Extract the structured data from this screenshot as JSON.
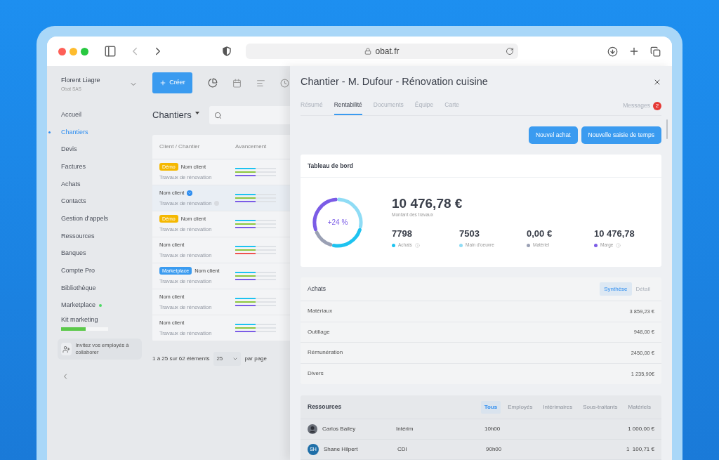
{
  "browser": {
    "url": "obat.fr"
  },
  "user": {
    "name": "Florent Liagre",
    "company": "Obat SAS"
  },
  "nav": [
    {
      "label": "Accueil",
      "selected": false
    },
    {
      "label": "Chantiers",
      "selected": true
    },
    {
      "label": "Devis",
      "selected": false
    },
    {
      "label": "Factures",
      "selected": false
    },
    {
      "label": "Achats",
      "selected": false
    },
    {
      "label": "Contacts",
      "selected": false
    },
    {
      "label": "Gestion d’appels",
      "selected": false
    },
    {
      "label": "Ressources",
      "selected": false
    },
    {
      "label": "Banques",
      "selected": false
    },
    {
      "label": "Compte Pro",
      "selected": false
    },
    {
      "label": "Bibliothèque",
      "selected": false
    },
    {
      "label": "Marketplace",
      "selected": false,
      "color": "#4cd964"
    },
    {
      "label": "Kit marketing",
      "selected": false,
      "level": 0.52
    }
  ],
  "invite": "Invitez vos employés à collaborer",
  "create_button": "Créer",
  "list": {
    "title": "Chantiers",
    "columns": [
      "Client / Chantier",
      "Avancement"
    ],
    "rows": [
      {
        "name": "Nom client",
        "subtitle": "Travaux de rénovation",
        "tag": {
          "kind": "demo",
          "label": "Démo"
        },
        "selected": false,
        "bars": [
          {
            "color": "#1ec3f0",
            "level": 0.5
          },
          {
            "color": "#8cc63f",
            "level": 0.5
          },
          {
            "color": "#7b5ce6",
            "level": 0.5
          }
        ]
      },
      {
        "name": "Nom client",
        "subtitle": "Travaux de rénovation",
        "selected": true,
        "bars": [
          {
            "color": "#1ec3f0",
            "level": 0.5
          },
          {
            "color": "#8cc63f",
            "level": 0.5
          },
          {
            "color": "#7b5ce6",
            "level": 0.5
          }
        ]
      },
      {
        "name": "Nom client",
        "subtitle": "Travaux de rénovation",
        "tag": {
          "kind": "demo",
          "label": "Démo"
        },
        "selected": false,
        "bars": [
          {
            "color": "#1ec3f0",
            "level": 0.5
          },
          {
            "color": "#8cc63f",
            "level": 0.5
          },
          {
            "color": "#7b5ce6",
            "level": 0.5
          }
        ]
      },
      {
        "name": "Nom client",
        "subtitle": "Travaux de rénovation",
        "selected": false,
        "bars": [
          {
            "color": "#1ec3f0",
            "level": 0.5
          },
          {
            "color": "#8cc63f",
            "level": 0.5
          },
          {
            "color": "#ef5350",
            "level": 0.5
          }
        ]
      },
      {
        "name": "Nom client",
        "subtitle": "Travaux de rénovation",
        "tag": {
          "kind": "marketplace",
          "label": "Marketplace"
        },
        "selected": false,
        "bars": [
          {
            "color": "#1ec3f0",
            "level": 0.5
          },
          {
            "color": "#8cc63f",
            "level": 0.5
          },
          {
            "color": "#7b5ce6",
            "level": 0.5
          }
        ]
      },
      {
        "name": "Nom client",
        "subtitle": "Travaux de rénovation",
        "selected": false,
        "bars": [
          {
            "color": "#1ec3f0",
            "level": 0.5
          },
          {
            "color": "#8cc63f",
            "level": 0.5
          },
          {
            "color": "#7b5ce6",
            "level": 0.5
          }
        ]
      },
      {
        "name": "Nom client",
        "subtitle": "Travaux de rénovation",
        "selected": false,
        "bars": [
          {
            "color": "#1ec3f0",
            "level": 0.5
          },
          {
            "color": "#8cc63f",
            "level": 0.5
          },
          {
            "color": "#7b5ce6",
            "level": 0.5
          }
        ]
      }
    ],
    "pagination": {
      "summary": "1 à 25 sur 62 éléments",
      "page_size": "25",
      "suffix": "par page"
    }
  },
  "panel": {
    "title": "Chantier - M. Dufour - Rénovation cuisine",
    "tabs": [
      {
        "label": "Résumé",
        "selected": false
      },
      {
        "label": "Rentabilité",
        "selected": true
      },
      {
        "label": "Documents",
        "selected": false
      },
      {
        "label": "Équipe",
        "selected": false
      },
      {
        "label": "Carte",
        "selected": false
      }
    ],
    "messages": {
      "label": "Messages",
      "count": "2"
    },
    "buttons": [
      "Nouvel achat",
      "Nouvelle saisie de temps"
    ],
    "dashboard": {
      "title": "Tableau de bord",
      "donut_label": "+24 %",
      "amount": "10 476,78 €",
      "amount_label": "Montant des travaux",
      "stats": [
        {
          "value": "7798",
          "label": "Achats",
          "color": "#1ec3f0",
          "info": true
        },
        {
          "value": "7503",
          "label": "Main d’oeuvre",
          "color": "#8fdcf5"
        },
        {
          "value": "0,00 €",
          "label": "Matériel",
          "color": "#9aa0b4"
        },
        {
          "value": "10 476,78",
          "label": "Marge",
          "color": "#7b5ce6",
          "info": true
        }
      ]
    },
    "purchases": {
      "title": "Achats",
      "views": [
        {
          "label": "Synthèse",
          "selected": true
        },
        {
          "label": "Détail",
          "selected": false
        }
      ],
      "rows": [
        {
          "label": "Matériaux",
          "value": "3 859,23 €"
        },
        {
          "label": "Outillage",
          "value": "948,00 €"
        },
        {
          "label": "Rémunération",
          "value": "2450,00 €"
        },
        {
          "label": "Divers",
          "value": "1 235,90€"
        }
      ]
    },
    "resources": {
      "title": "Ressources",
      "filters": [
        {
          "label": "Tous",
          "selected": true
        },
        {
          "label": "Employés",
          "selected": false
        },
        {
          "label": "Intérimaires",
          "selected": false
        },
        {
          "label": "Sous-traitants",
          "selected": false
        },
        {
          "label": "Matériels",
          "selected": false
        }
      ],
      "rows": [
        {
          "avatar": {
            "kind": "photo"
          },
          "name": "Carlos Bailey",
          "contract": "Intérim",
          "hours": "10h00",
          "amount": "1 000,00 €"
        },
        {
          "avatar": {
            "kind": "initials",
            "text": "SH"
          },
          "name": "Shane Hilpert",
          "contract": "CDI",
          "hours": "90h00",
          "amount": "1  100,71 €"
        }
      ]
    }
  }
}
